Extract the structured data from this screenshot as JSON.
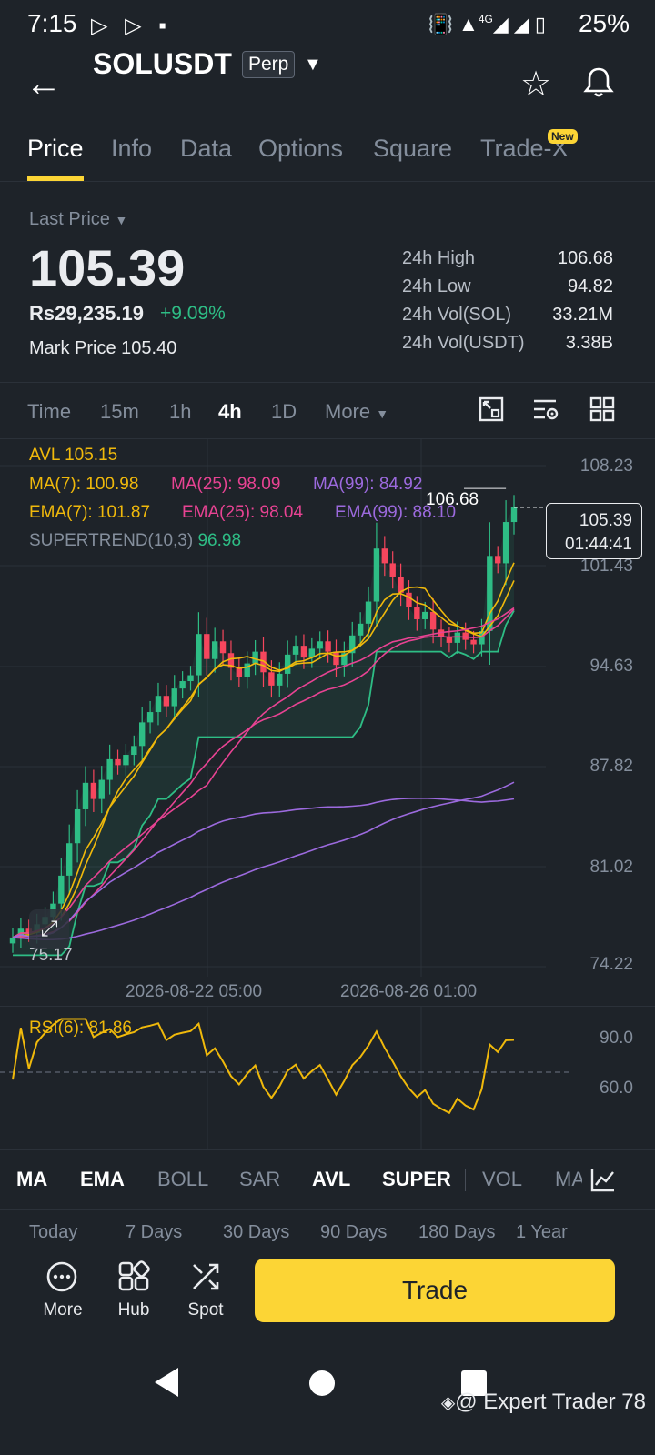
{
  "status_bar": {
    "time": "7:15",
    "battery": "25%",
    "network": "4G"
  },
  "header": {
    "symbol": "SOLUSDT",
    "badge": "Perp"
  },
  "tabs": [
    {
      "label": "Price"
    },
    {
      "label": "Info"
    },
    {
      "label": "Data"
    },
    {
      "label": "Options"
    },
    {
      "label": "Square"
    },
    {
      "label": "Trade-X"
    }
  ],
  "tab_badge": "New",
  "price": {
    "last_price_label": "Last Price",
    "last_price": "105.39",
    "local_price": "Rs29,235.19",
    "change": "+9.09%",
    "mark_label": "Mark Price",
    "mark_value": "105.40"
  },
  "stats": [
    {
      "label": "24h High",
      "value": "106.68"
    },
    {
      "label": "24h Low",
      "value": "94.82"
    },
    {
      "label": "24h Vol(SOL)",
      "value": "33.21M"
    },
    {
      "label": "24h Vol(USDT)",
      "value": "3.38B"
    }
  ],
  "intervals": [
    "Time",
    "15m",
    "1h",
    "4h",
    "1D",
    "More"
  ],
  "legend": {
    "avl": "AVL 105.15",
    "ma7": "MA(7): 100.98",
    "ma25": "MA(25): 98.09",
    "ma99": "MA(99): 84.92",
    "ema7": "EMA(7): 101.87",
    "ema25": "EMA(25): 98.04",
    "ema99": "EMA(99): 88.10",
    "supertrend_label": "SUPERTREND(10,3)",
    "supertrend_value": "96.98"
  },
  "price_axis": [
    "108.23",
    "101.43",
    "94.63",
    "87.82",
    "81.02",
    "74.22"
  ],
  "high_marker": "106.68",
  "low_marker": "75.17",
  "current": {
    "price": "105.39",
    "countdown": "01:44:41"
  },
  "dates": [
    "2026-08-22 05:00",
    "2026-08-26 01:00"
  ],
  "rsi": {
    "label": "RSI(6): 81.86",
    "axis": [
      "90.0",
      "60.0"
    ]
  },
  "indicators": [
    {
      "label": "MA",
      "on": true
    },
    {
      "label": "EMA",
      "on": true
    },
    {
      "label": "BOLL",
      "on": false
    },
    {
      "label": "SAR",
      "on": false
    },
    {
      "label": "AVL",
      "on": true
    },
    {
      "label": "SUPER",
      "on": true
    },
    {
      "label": "VOL",
      "on": false
    },
    {
      "label": "MA",
      "on": false
    }
  ],
  "ranges": [
    "Today",
    "7 Days",
    "30 Days",
    "90 Days",
    "180 Days",
    "1 Year"
  ],
  "actions": [
    {
      "label": "More"
    },
    {
      "label": "Hub"
    },
    {
      "label": "Spot"
    }
  ],
  "trade_label": "Trade",
  "watermark": "@ Expert Trader 78",
  "colors": {
    "accent": "#fcd535",
    "up": "#2ebd85",
    "down": "#f6465d",
    "bg": "#1e2329"
  },
  "chart_data": {
    "type": "candlestick",
    "interval": "4h",
    "ylim": [
      74.22,
      108.23
    ],
    "x": [
      "2026-08-22 05:00",
      "2026-08-26 01:00"
    ],
    "series": [
      {
        "name": "MA(7)",
        "last": 100.98
      },
      {
        "name": "MA(25)",
        "last": 98.09
      },
      {
        "name": "MA(99)",
        "last": 84.92
      },
      {
        "name": "EMA(7)",
        "last": 101.87
      },
      {
        "name": "EMA(25)",
        "last": 98.04
      },
      {
        "name": "EMA(99)",
        "last": 88.1
      },
      {
        "name": "SUPERTREND(10,3)",
        "last": 96.98
      }
    ],
    "close": [
      76.2,
      76.8,
      76.5,
      77.1,
      77.6,
      78.5,
      80.4,
      82.6,
      84.9,
      86.7,
      85.6,
      86.9,
      88.3,
      87.9,
      88.6,
      89.2,
      90.8,
      91.5,
      92.6,
      91.9,
      93.1,
      93.6,
      94.0,
      96.8,
      95.1,
      96.3,
      95.5,
      94.5,
      93.9,
      94.8,
      95.6,
      94.2,
      93.3,
      94.1,
      95.4,
      96.0,
      95.2,
      95.8,
      96.3,
      95.6,
      94.7,
      95.5,
      96.7,
      97.5,
      99.0,
      102.6,
      101.6,
      100.7,
      99.6,
      98.6,
      97.8,
      98.3,
      97.1,
      96.6,
      96.2,
      96.9,
      96.4,
      96.1,
      97.0,
      102.1,
      101.6,
      104.4,
      105.39
    ],
    "rsi_axis": [
      90.0,
      60.0
    ],
    "rsi_last": 81.86
  }
}
